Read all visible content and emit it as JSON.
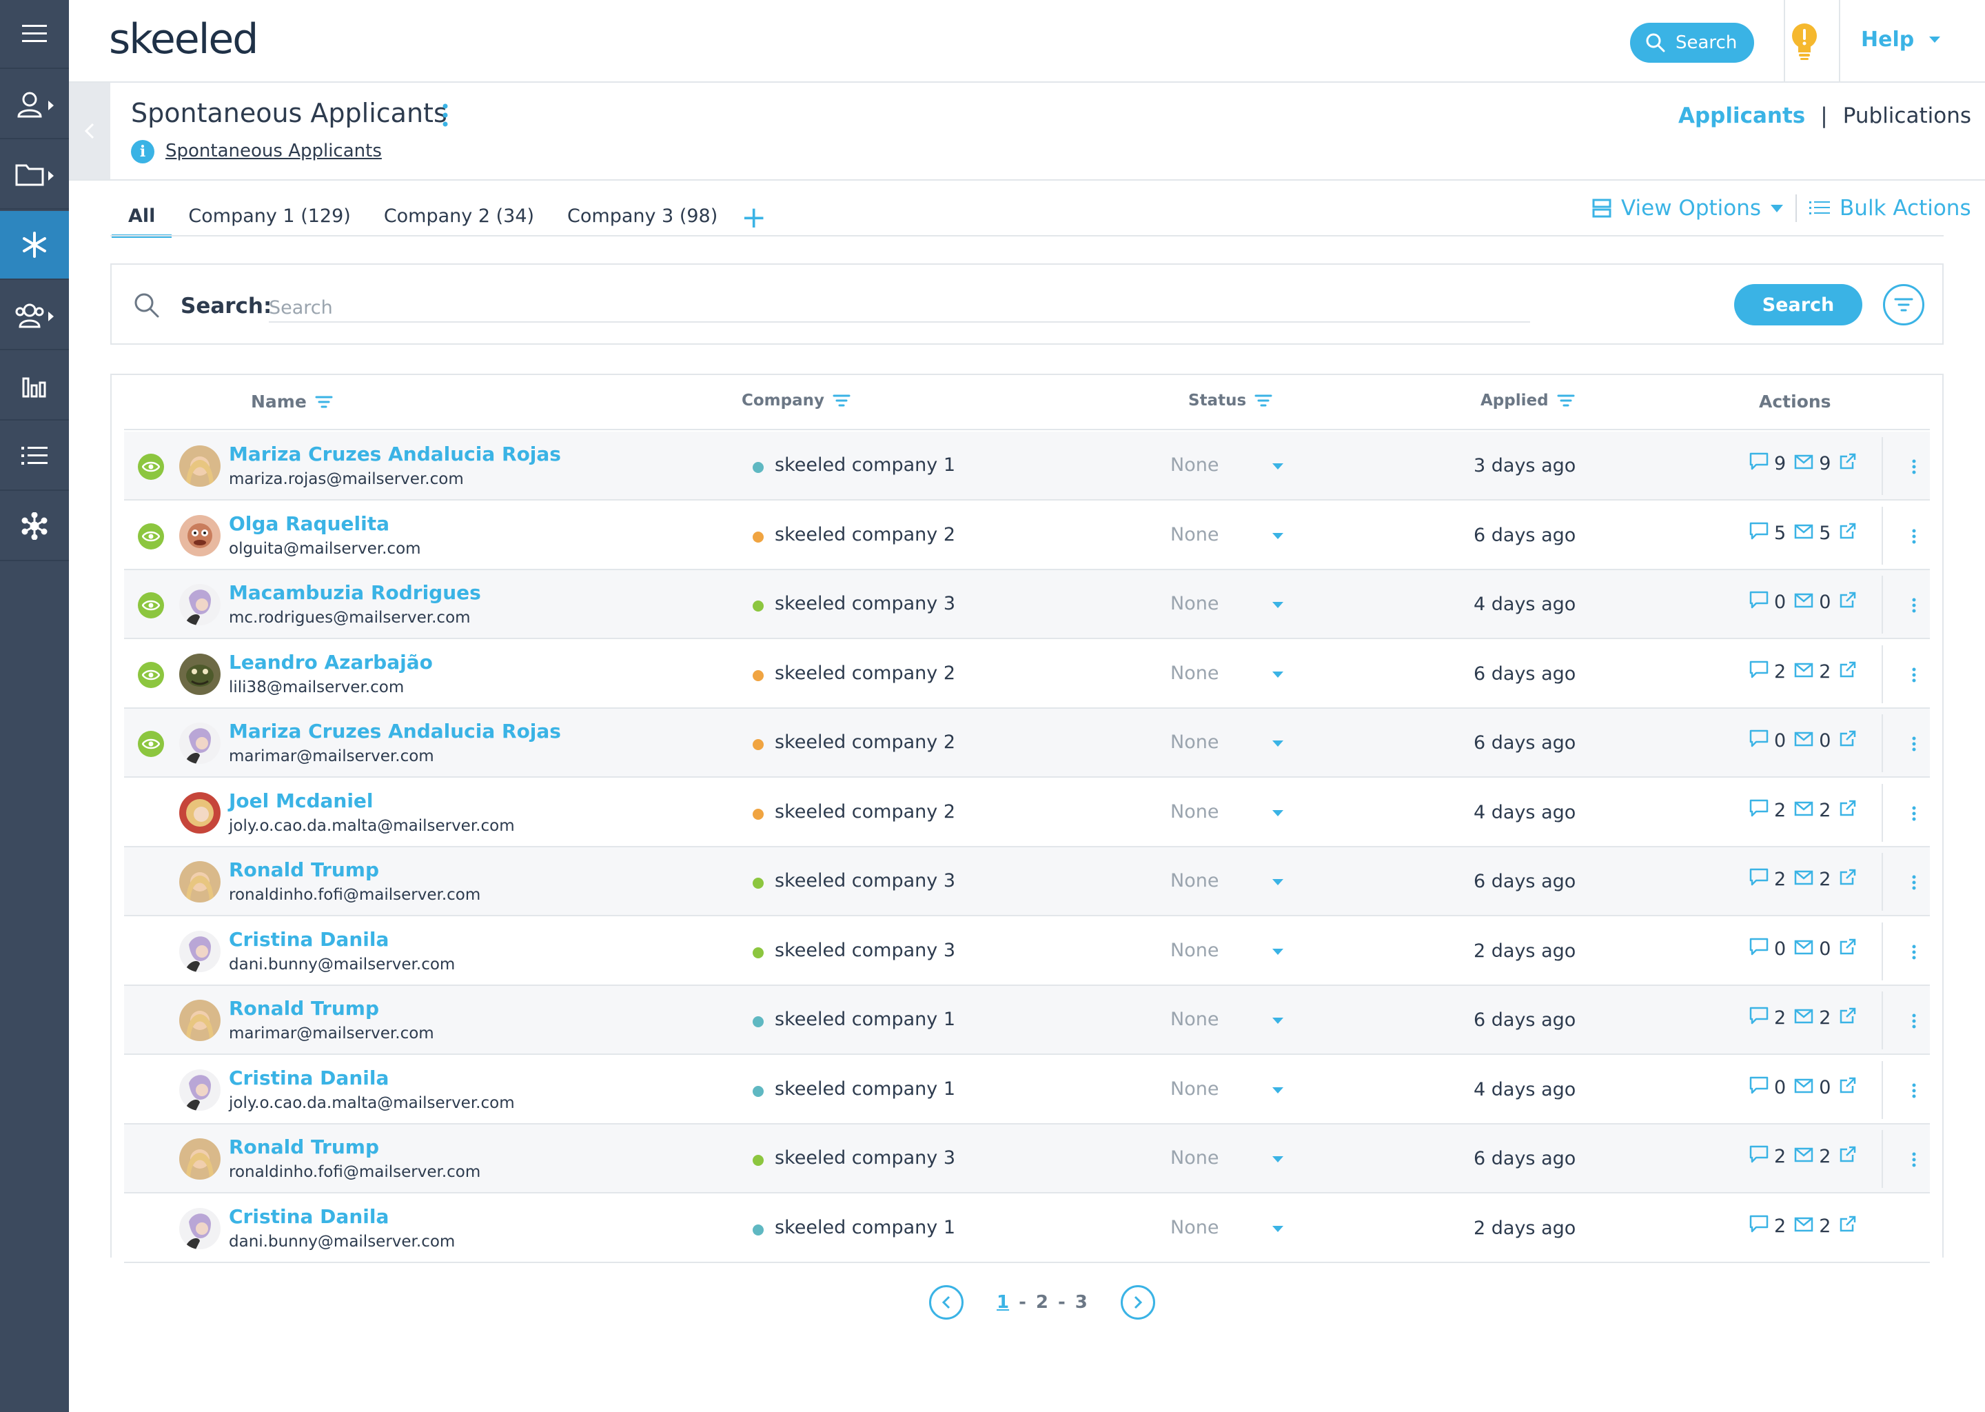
{
  "brand": {
    "logo_text": "skeeled",
    "accent": "#3ab3e5",
    "sidebar_bg": "#3c4a5e",
    "active_nav": "#2d86bf"
  },
  "sidebar": {
    "items": [
      {
        "icon": "menu-icon"
      },
      {
        "icon": "user-icon"
      },
      {
        "icon": "folder-icon"
      },
      {
        "icon": "asterisk-icon",
        "active": true
      },
      {
        "icon": "group-icon"
      },
      {
        "icon": "bar-chart-icon"
      },
      {
        "icon": "list-icon"
      },
      {
        "icon": "network-icon"
      }
    ]
  },
  "header": {
    "search_label": "Search",
    "help_label": "Help"
  },
  "page": {
    "title": "Spontaneous Applicants",
    "breadcrumb": "Spontaneous Applicants",
    "nav_applicants": "Applicants",
    "nav_sep": "|",
    "nav_publications": "Publications"
  },
  "tabs": [
    {
      "label": "All",
      "active": true
    },
    {
      "label": "Company 1 (129)"
    },
    {
      "label": "Company 2 (34)"
    },
    {
      "label": "Company 3 (98)"
    }
  ],
  "toolbar": {
    "view_options": "View Options",
    "bulk_actions": "Bulk Actions"
  },
  "search": {
    "label": "Search:",
    "placeholder": "Search",
    "button": "Search"
  },
  "table": {
    "headers": {
      "name": "Name",
      "company": "Company",
      "status": "Status",
      "applied": "Applied",
      "actions": "Actions"
    },
    "company_colors": {
      "skeeled company 1": "#5fb8c2",
      "skeeled company 2": "#f0a441",
      "skeeled company 3": "#8cc63f"
    },
    "rows": [
      {
        "viewed": true,
        "avatar": "blonde",
        "name": "Mariza Cruzes Andalucia Rojas",
        "email": "mariza.rojas@mailserver.com",
        "company": "skeeled company 1",
        "status": "None",
        "applied": "3 days ago",
        "comments": "9",
        "messages": "9",
        "alt": true
      },
      {
        "viewed": true,
        "avatar": "puppet",
        "name": "Olga Raquelita",
        "email": "olguita@mailserver.com",
        "company": "skeeled company 2",
        "status": "None",
        "applied": "6 days ago",
        "comments": "5",
        "messages": "5",
        "alt": false
      },
      {
        "viewed": true,
        "avatar": "purple",
        "name": "Macambuzia Rodrigues",
        "email": "mc.rodrigues@mailserver.com",
        "company": "skeeled company 3",
        "status": "None",
        "applied": "4 days ago",
        "comments": "0",
        "messages": "0",
        "alt": true
      },
      {
        "viewed": true,
        "avatar": "lizard",
        "name": "Leandro Azarbajão",
        "email": "lili38@mailserver.com",
        "company": "skeeled company 2",
        "status": "None",
        "applied": "6 days ago",
        "comments": "2",
        "messages": "2",
        "alt": false
      },
      {
        "viewed": true,
        "avatar": "purple",
        "name": "Mariza Cruzes Andalucia Rojas",
        "email": "marimar@mailserver.com",
        "company": "skeeled company 2",
        "status": "None",
        "applied": "6 days ago",
        "comments": "0",
        "messages": "0",
        "alt": true
      },
      {
        "viewed": false,
        "avatar": "curly",
        "name": "Joel Mcdaniel",
        "email": "joly.o.cao.da.malta@mailserver.com",
        "company": "skeeled company 2",
        "status": "None",
        "applied": "4 days ago",
        "comments": "2",
        "messages": "2",
        "alt": false
      },
      {
        "viewed": false,
        "avatar": "blonde",
        "name": "Ronald Trump",
        "email": "ronaldinho.fofi@mailserver.com",
        "company": "skeeled company 3",
        "status": "None",
        "applied": "6 days ago",
        "comments": "2",
        "messages": "2",
        "alt": true
      },
      {
        "viewed": false,
        "avatar": "purple",
        "name": "Cristina Danila",
        "email": "dani.bunny@mailserver.com",
        "company": "skeeled company 3",
        "status": "None",
        "applied": "2 days ago",
        "comments": "0",
        "messages": "0",
        "alt": false
      },
      {
        "viewed": false,
        "avatar": "blonde",
        "name": "Ronald Trump",
        "email": "marimar@mailserver.com",
        "company": "skeeled company 1",
        "status": "None",
        "applied": "6 days ago",
        "comments": "2",
        "messages": "2",
        "alt": true
      },
      {
        "viewed": false,
        "avatar": "purple",
        "name": "Cristina Danila",
        "email": "joly.o.cao.da.malta@mailserver.com",
        "company": "skeeled company 1",
        "status": "None",
        "applied": "4 days ago",
        "comments": "0",
        "messages": "0",
        "alt": false
      },
      {
        "viewed": false,
        "avatar": "blonde",
        "name": "Ronald Trump",
        "email": "ronaldinho.fofi@mailserver.com",
        "company": "skeeled company 3",
        "status": "None",
        "applied": "6 days ago",
        "comments": "2",
        "messages": "2",
        "alt": true
      },
      {
        "viewed": false,
        "avatar": "purple",
        "name": "Cristina Danila",
        "email": "dani.bunny@mailserver.com",
        "company": "skeeled company 1",
        "status": "None",
        "applied": "2 days ago",
        "comments": "2",
        "messages": "2",
        "alt": false
      }
    ]
  },
  "pagination": {
    "pages": [
      "1",
      "2",
      "3"
    ],
    "separator": "-",
    "current": "1"
  }
}
